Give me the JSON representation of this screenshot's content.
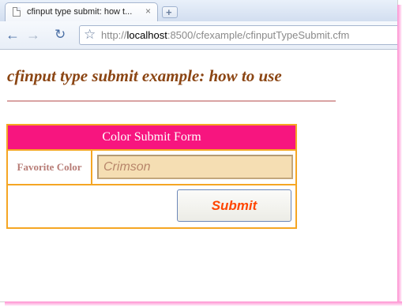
{
  "browser": {
    "tab_title": "cfinput type submit: how t...",
    "tab_close": "×",
    "new_tab": "+",
    "url_prefix": "http://",
    "url_host": "localhost",
    "url_rest": ":8500/cfexample/cfinputTypeSubmit.cfm"
  },
  "page": {
    "heading": "cfinput type submit example: how to use",
    "form": {
      "title": "Color Submit Form",
      "label": "Favorite Color",
      "input_value": "Crimson",
      "submit_label": "Submit"
    }
  },
  "colors": {
    "header_bg": "#f7157f",
    "border": "#f5a623",
    "heading": "#8b4513",
    "input_bg": "#f5deb3",
    "submit_text": "#ff4500"
  }
}
